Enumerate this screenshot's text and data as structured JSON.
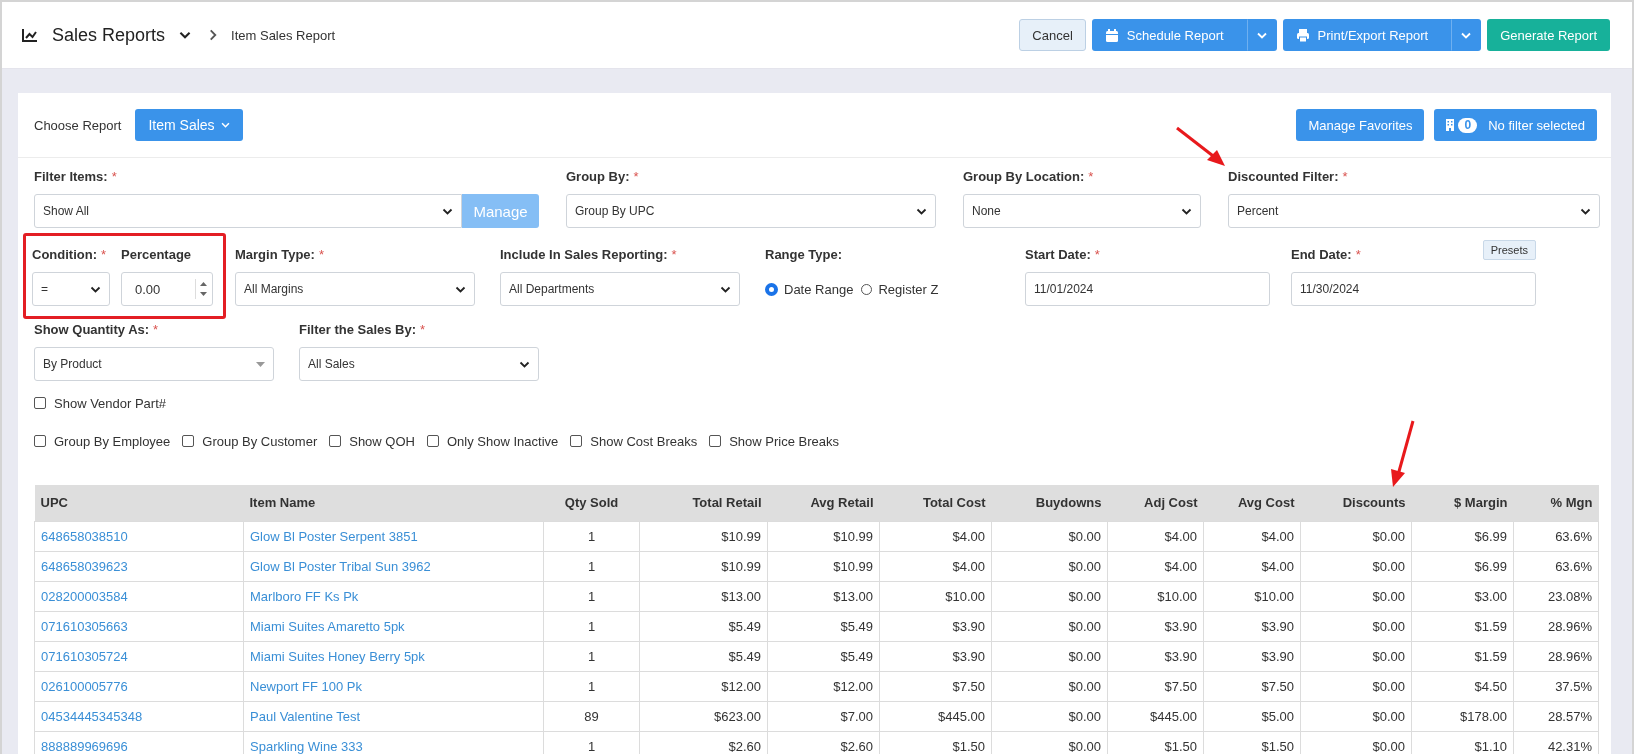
{
  "header": {
    "title": "Sales Reports",
    "breadcrumb": "Item Sales Report",
    "buttons": [
      {
        "label": "Cancel",
        "kind": "secondary"
      },
      {
        "label": "Schedule Report",
        "kind": "split"
      },
      {
        "label": "Print/Export Report",
        "kind": "split"
      },
      {
        "label": "Generate Report",
        "kind": "success"
      }
    ]
  },
  "choose_report": {
    "label": "Choose Report",
    "value": "Item Sales"
  },
  "favorites_button": "Manage Favorites",
  "filter_button": {
    "count": "0",
    "label": "No filter selected"
  },
  "form_rows": [
    [
      {
        "label": "Filter Items:",
        "required_mark": "*",
        "kind": "select",
        "value": "Show All",
        "action": "Manage"
      },
      {
        "label": "Group By:",
        "required_mark": "*",
        "kind": "select",
        "value": "Group By UPC"
      },
      {
        "label": "Group By Location:",
        "required_mark": "*",
        "kind": "select",
        "value": "None"
      },
      {
        "label": "Discounted Filter:",
        "required_mark": "*",
        "kind": "select",
        "value": "Percent"
      }
    ],
    [
      {
        "label": "Condition:",
        "required_mark": "*",
        "kind": "select",
        "value": "="
      },
      {
        "label": "Percentage",
        "kind": "number",
        "value": "0.00"
      },
      {
        "label": "Margin Type:",
        "required_mark": "*",
        "kind": "select",
        "value": "All Margins"
      },
      {
        "label": "Include In Sales Reporting:",
        "required_mark": "*",
        "kind": "select",
        "value": "All Departments"
      },
      {
        "label": "Range Type:",
        "kind": "radio",
        "options": [
          {
            "label": "Date Range",
            "selected": true
          },
          {
            "label": "Register Z",
            "selected": false
          }
        ]
      },
      {
        "label": "Start Date:",
        "required_mark": "*",
        "kind": "text",
        "value": "11/01/2024"
      },
      {
        "label": "End Date:",
        "required_mark": "*",
        "kind": "text",
        "value": "11/30/2024",
        "action": "Presets"
      }
    ],
    [
      {
        "label": "Show Quantity As:",
        "required_mark": "*",
        "kind": "combo",
        "value": "By Product"
      },
      {
        "label": "Filter the Sales By:",
        "required_mark": "*",
        "kind": "select",
        "value": "All Sales"
      }
    ]
  ],
  "vendor_options": [
    {
      "label": "Show Vendor Part#",
      "checked": false
    }
  ],
  "options": [
    {
      "label": "Group By Employee",
      "checked": false
    },
    {
      "label": "Group By Customer",
      "checked": false
    },
    {
      "label": "Show QOH",
      "checked": false
    },
    {
      "label": "Only Show Inactive",
      "checked": false
    },
    {
      "label": "Show Cost Breaks",
      "checked": false
    },
    {
      "label": "Show Price Breaks",
      "checked": false
    }
  ],
  "table": {
    "columns": [
      {
        "label": "UPC",
        "kind": "link"
      },
      {
        "label": "Item Name",
        "kind": "link"
      },
      {
        "label": "Qty Sold",
        "kind": "count"
      },
      {
        "label": "Total Retail",
        "kind": "money"
      },
      {
        "label": "Avg Retail",
        "kind": "money"
      },
      {
        "label": "Total Cost",
        "kind": "money"
      },
      {
        "label": "Buydowns",
        "kind": "money"
      },
      {
        "label": "Adj Cost",
        "kind": "money"
      },
      {
        "label": "Avg Cost",
        "kind": "money"
      },
      {
        "label": "Discounts",
        "kind": "money"
      },
      {
        "label": "$ Margin",
        "kind": "money"
      },
      {
        "label": "% Mgn",
        "kind": "money"
      }
    ],
    "rows": [
      [
        "648658038510",
        "Glow Bl Poster Serpent 3851",
        "1",
        "$10.99",
        "$10.99",
        "$4.00",
        "$0.00",
        "$4.00",
        "$4.00",
        "$0.00",
        "$6.99",
        "63.6%"
      ],
      [
        "648658039623",
        "Glow Bl Poster Tribal Sun 3962",
        "1",
        "$10.99",
        "$10.99",
        "$4.00",
        "$0.00",
        "$4.00",
        "$4.00",
        "$0.00",
        "$6.99",
        "63.6%"
      ],
      [
        "028200003584",
        "Marlboro FF Ks Pk",
        "1",
        "$13.00",
        "$13.00",
        "$10.00",
        "$0.00",
        "$10.00",
        "$10.00",
        "$0.00",
        "$3.00",
        "23.08%"
      ],
      [
        "071610305663",
        "Miami Suites Amaretto 5pk",
        "1",
        "$5.49",
        "$5.49",
        "$3.90",
        "$0.00",
        "$3.90",
        "$3.90",
        "$0.00",
        "$1.59",
        "28.96%"
      ],
      [
        "071610305724",
        "Miami Suites Honey Berry 5pk",
        "1",
        "$5.49",
        "$5.49",
        "$3.90",
        "$0.00",
        "$3.90",
        "$3.90",
        "$0.00",
        "$1.59",
        "28.96%"
      ],
      [
        "026100005776",
        "Newport FF 100 Pk",
        "1",
        "$12.00",
        "$12.00",
        "$7.50",
        "$0.00",
        "$7.50",
        "$7.50",
        "$0.00",
        "$4.50",
        "37.5%"
      ],
      [
        "04534445345348",
        "Paul Valentine Test",
        "89",
        "$623.00",
        "$7.00",
        "$445.00",
        "$0.00",
        "$445.00",
        "$5.00",
        "$0.00",
        "$178.00",
        "28.57%"
      ],
      [
        "888889969696",
        "Sparkling Wine 333",
        "1",
        "$2.60",
        "$2.60",
        "$1.50",
        "$0.00",
        "$1.50",
        "$1.50",
        "$0.00",
        "$1.10",
        "42.31%"
      ]
    ]
  }
}
